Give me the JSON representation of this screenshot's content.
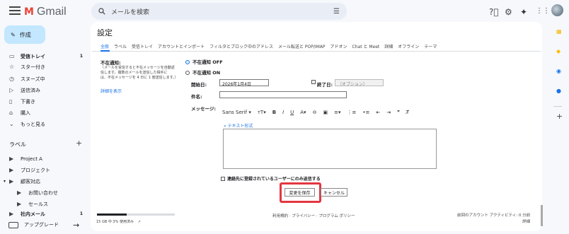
{
  "app": {
    "name": "Gmail",
    "logo_letter": "M"
  },
  "search": {
    "placeholder": "メールを検索",
    "search_icon": "search-icon",
    "filter_icon": "tune-icon"
  },
  "header_icons": [
    "help-icon",
    "settings-icon",
    "gemini-icon",
    "apps-icon",
    "avatar"
  ],
  "compose": {
    "label": "作成"
  },
  "nav": [
    {
      "label": "受信トレイ",
      "count": "1",
      "icon": "inbox-icon",
      "bold": true
    },
    {
      "label": "スター付き",
      "icon": "star-icon"
    },
    {
      "label": "スヌーズ中",
      "icon": "clock-icon"
    },
    {
      "label": "送信済み",
      "icon": "send-icon"
    },
    {
      "label": "下書き",
      "icon": "draft-icon"
    },
    {
      "label": "購入",
      "icon": "tag-icon"
    },
    {
      "label": "もっと見る",
      "icon": "chevron-down-icon"
    }
  ],
  "labels": {
    "header": "ラベル",
    "items": [
      {
        "label": "Project A"
      },
      {
        "label": "プロジェクト"
      },
      {
        "label": "顧客対応",
        "expanded": true
      },
      {
        "label": "お問い合わせ",
        "indent": true
      },
      {
        "label": "セールス",
        "indent": true
      },
      {
        "label": "社内メール",
        "count": "1",
        "bold": true
      }
    ]
  },
  "upgrade": {
    "label": "アップグレード"
  },
  "settings": {
    "title": "設定",
    "tabs": [
      "全般",
      "ラベル",
      "受信トレイ",
      "アカウントとインポート",
      "フィルタとブロック中のアドレス",
      "メール転送と POP/IMAP",
      "アドオン",
      "Chat と Meet",
      "詳細",
      "オフライン",
      "テーマ"
    ],
    "active_tab": "全般",
    "vacation": {
      "label": "不在通知:",
      "desc_lines": [
        "（メールを受信すると不在メッセージを自動返",
        "信します。複数のメールを送信した相手に",
        "は、不在メッセージを 4 日に 1 度送信します。）"
      ],
      "details_link": "詳細を表示",
      "off_label": "不在通知 OFF",
      "on_label": "不在通知 ON",
      "selected": "off",
      "start_label": "開始日:",
      "start_value": "2026年1月4日",
      "end_label": "終了日:",
      "end_placeholder": "（オプション）",
      "subject_label": "件名:",
      "subject_value": "",
      "message_label": "メッセージ:",
      "font_name": "Sans Serif",
      "plain_text_link": "« テキスト形式",
      "contacts_only_label": "連絡先に登録されているユーザーにのみ返信する"
    },
    "save_label": "変更を保存",
    "cancel_label": "キャンセル"
  },
  "footer": {
    "storage_text": "15 GB 中 3% 使用済み",
    "storage_fraction": 0.03,
    "links": "利用規約 · プライバシー · プログラム ポリシー",
    "activity_line": "前回のアカウント アクティビティ: 0 分前",
    "details": "詳細"
  },
  "colors": {
    "accent": "#1a73e8",
    "compose_bg": "#c2e7ff",
    "highlight": "#e3363f"
  }
}
